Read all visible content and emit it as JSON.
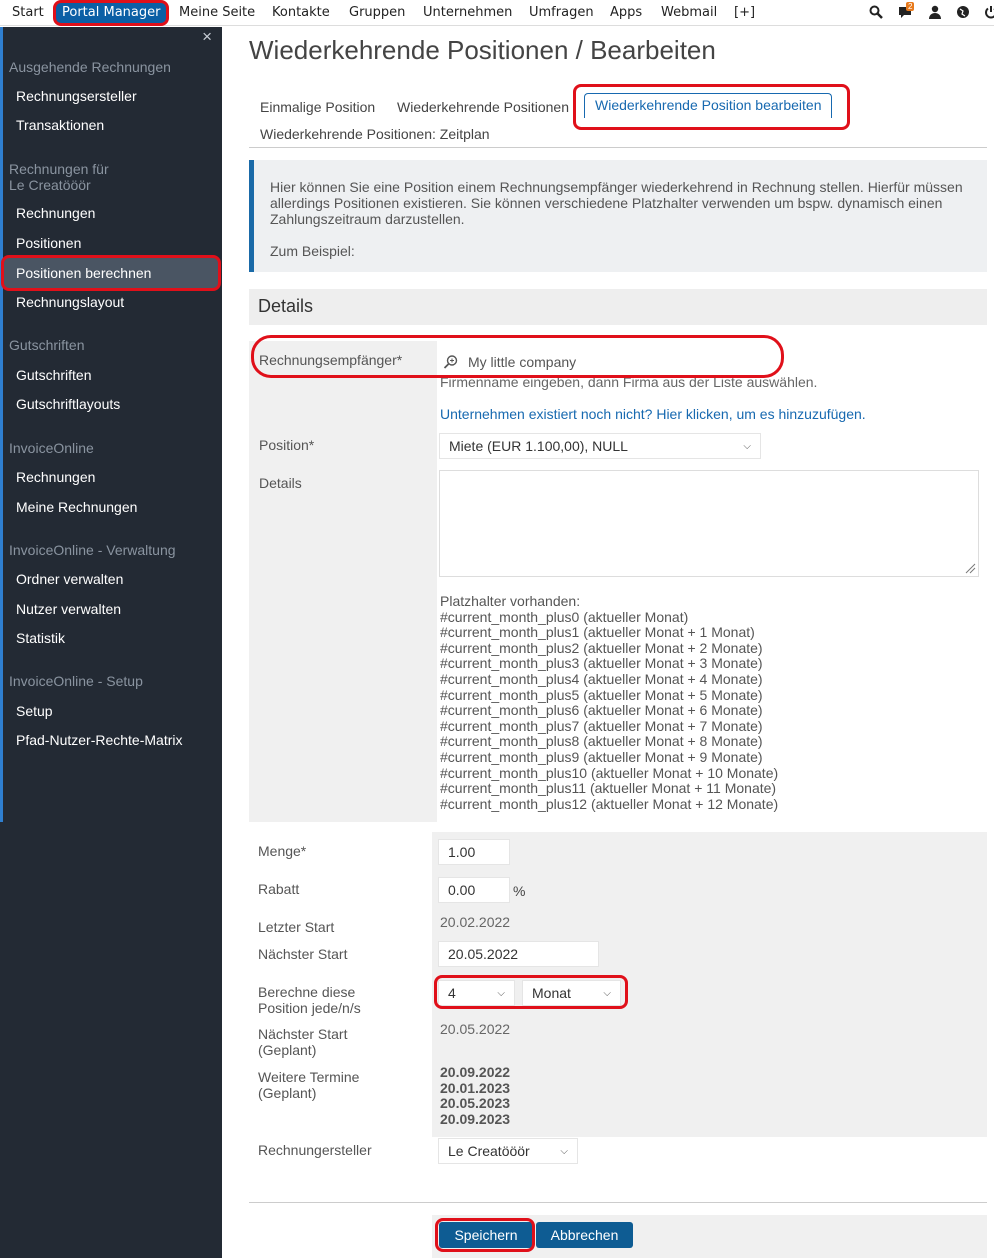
{
  "topnav": {
    "items": [
      "Start",
      "Portal Manager",
      "Meine Seite",
      "Kontakte",
      "Gruppen",
      "Unternehmen",
      "Umfragen",
      "Apps",
      "Webmail",
      "[+]"
    ],
    "notification_count": "2"
  },
  "sidebar": {
    "close": "×",
    "sections": [
      {
        "title": "Ausgehende Rechnungen",
        "items": [
          "Rechnungsersteller",
          "Transaktionen"
        ]
      },
      {
        "title": "Rechnungen für\nLe Creatööör",
        "items": [
          "Rechnungen",
          "Positionen",
          "Positionen berechnen",
          "Rechnungslayout"
        ]
      },
      {
        "title": "Gutschriften",
        "items": [
          "Gutschriften",
          "Gutschriftlayouts"
        ]
      },
      {
        "title": "InvoiceOnline",
        "items": [
          "Rechnungen",
          "Meine Rechnungen"
        ]
      },
      {
        "title": "InvoiceOnline - Verwaltung",
        "items": [
          "Ordner verwalten",
          "Nutzer verwalten",
          "Statistik"
        ]
      },
      {
        "title": "InvoiceOnline - Setup",
        "items": [
          "Setup",
          "Pfad-Nutzer-Rechte-Matrix"
        ]
      }
    ]
  },
  "page": {
    "title": "Wiederkehrende Positionen / Bearbeiten",
    "tabs": [
      "Einmalige Position",
      "Wiederkehrende Positionen",
      "Wiederkehrende Position bearbeiten",
      "Wiederkehrende Positionen: Zeitplan"
    ],
    "info_text": "Hier können Sie eine Position einem Rechnungsempfänger wiederkehrend in Rechnung stellen. Hierfür müssen allerdings Positionen existieren. Sie können verschiedene Platzhalter verwenden um bspw. dynamisch einen Zahlungszeitraum darzustellen.",
    "info_example": "Zum Beispiel:",
    "details_heading": "Details"
  },
  "form": {
    "recipient_label": "Rechnungsempfänger*",
    "recipient_value": "My little company",
    "recipient_hint": "Firmenname eingeben, dann Firma aus der Liste auswählen.",
    "recipient_link": "Unternehmen existiert noch nicht? Hier klicken, um es hinzuzufügen.",
    "position_label": "Position*",
    "position_value": "Miete (EUR 1.100,00), NULL",
    "details_label": "Details",
    "details_value": "",
    "placeholders_title": "Platzhalter vorhanden:",
    "placeholders": [
      "#current_month_plus0 (aktueller Monat)",
      "#current_month_plus1 (aktueller Monat + 1 Monat)",
      "#current_month_plus2 (aktueller Monat + 2 Monate)",
      "#current_month_plus3 (aktueller Monat + 3 Monate)",
      "#current_month_plus4 (aktueller Monat + 4 Monate)",
      "#current_month_plus5 (aktueller Monat + 5 Monate)",
      "#current_month_plus6 (aktueller Monat + 6 Monate)",
      "#current_month_plus7 (aktueller Monat + 7 Monate)",
      "#current_month_plus8 (aktueller Monat + 8 Monate)",
      "#current_month_plus9 (aktueller Monat + 9 Monate)",
      "#current_month_plus10 (aktueller Monat + 10 Monate)",
      "#current_month_plus11 (aktueller Monat + 11 Monate)",
      "#current_month_plus12 (aktueller Monat + 12 Monate)"
    ],
    "quantity_label": "Menge*",
    "quantity_value": "1.00",
    "discount_label": "Rabatt",
    "discount_value": "0.00",
    "discount_unit": "%",
    "last_start_label": "Letzter Start",
    "last_start_value": "20.02.2022",
    "next_start_label": "Nächster Start",
    "next_start_value": "20.05.2022",
    "interval_label": "Berechne diese Position jede/n/s",
    "interval_value": "4",
    "interval_unit": "Monat",
    "next_planned_label": "Nächster Start (Geplant)",
    "next_planned_value": "20.05.2022",
    "further_label": "Weitere Termine (Geplant)",
    "further_dates": [
      "20.09.2022",
      "20.01.2023",
      "20.05.2023",
      "20.09.2023"
    ],
    "creator_label": "Rechnungersteller",
    "creator_value": "Le Creatööör"
  },
  "buttons": {
    "save": "Speichern",
    "cancel": "Abbrechen"
  }
}
